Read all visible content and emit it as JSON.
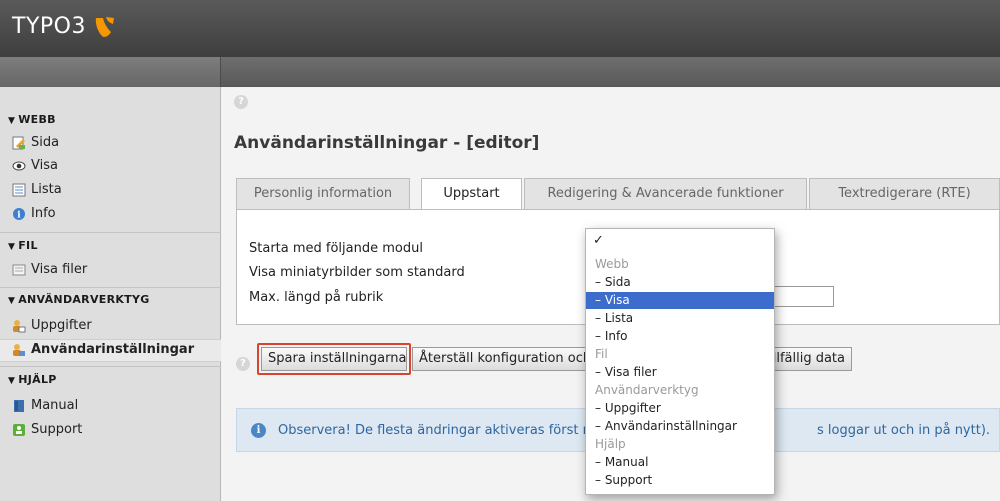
{
  "app": {
    "logo_text": "TYPO3"
  },
  "sidebar": {
    "groups": [
      {
        "label": "WEBB",
        "items": [
          "Sida",
          "Visa",
          "Lista",
          "Info"
        ]
      },
      {
        "label": "FIL",
        "items": [
          "Visa filer"
        ]
      },
      {
        "label": "ANVÄNDARVERKTYG",
        "items": [
          "Uppgifter",
          "Användarinställningar"
        ]
      },
      {
        "label": "HJÄLP",
        "items": [
          "Manual",
          "Support"
        ]
      }
    ]
  },
  "main": {
    "title": "Användarinställningar - [editor]",
    "tabs": [
      "Personlig information",
      "Uppstart",
      "Redigering & Avancerade funktioner",
      "Textredigerare (RTE)"
    ],
    "active_tab": "Uppstart",
    "fields": [
      "Starta med följande modul",
      "Visa miniatyrbilder som standard",
      "Max. längd på rubrik"
    ],
    "buttons": {
      "save": "Spara inställningarna",
      "reset": "Återställ konfiguration och rensa temporär data",
      "reset_visible": "Återställ konfiguration och",
      "reset_tail": "illfällig data"
    },
    "notice": {
      "text_left": "Observera! De flesta ändringar aktiveras först n",
      "text_right": "s loggar ut och in på nytt)."
    }
  },
  "dropdown": {
    "check": "✓",
    "options": [
      {
        "label": "Webb",
        "type": "header"
      },
      {
        "label": "– Sida",
        "type": "option"
      },
      {
        "label": "– Visa",
        "type": "option",
        "selected": true
      },
      {
        "label": "– Lista",
        "type": "option"
      },
      {
        "label": "– Info",
        "type": "option"
      },
      {
        "label": "Fil",
        "type": "header"
      },
      {
        "label": "– Visa filer",
        "type": "option"
      },
      {
        "label": "Användarverktyg",
        "type": "header"
      },
      {
        "label": "– Uppgifter",
        "type": "option"
      },
      {
        "label": "– Användarinställningar",
        "type": "option"
      },
      {
        "label": "Hjälp",
        "type": "header"
      },
      {
        "label": "– Manual",
        "type": "option"
      },
      {
        "label": "– Support",
        "type": "option"
      }
    ]
  },
  "colors": {
    "accent": "#3d6dcc",
    "focus_ring": "#d9452c",
    "typo3_orange": "#f49700"
  }
}
